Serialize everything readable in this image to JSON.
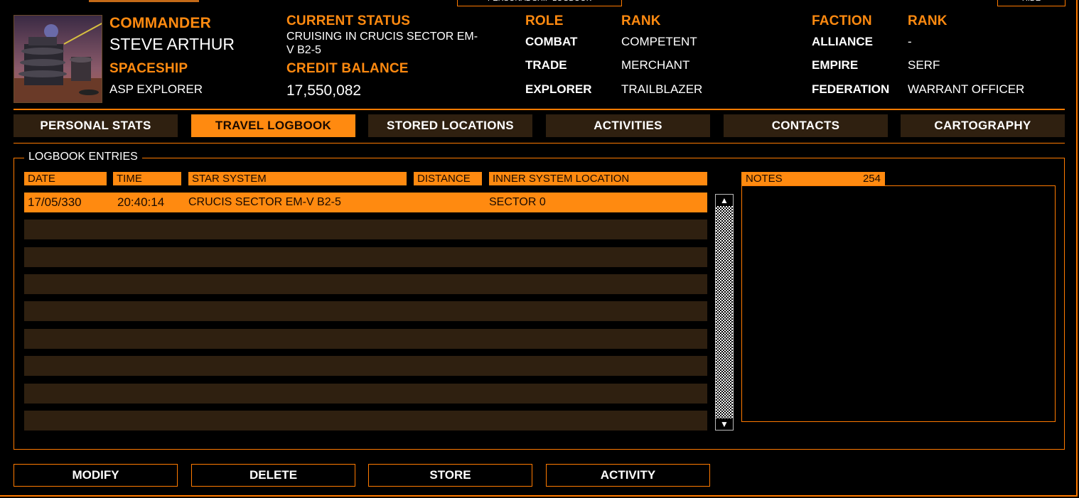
{
  "window": {
    "title": "PERSONAL SHIP LOGBOOK",
    "hide_label": "HIDE"
  },
  "header": {
    "commander_label": "COMMANDER",
    "commander_name": "STEVE ARTHUR",
    "spaceship_label": "SPACESHIP",
    "spaceship": "ASP EXPLORER",
    "status_label": "CURRENT STATUS",
    "status_line1": "CRUISING IN CRUCIS SECTOR EM-",
    "status_line2": "V B2-5",
    "credit_label": "CREDIT BALANCE",
    "credit": "17,550,082",
    "role_header": "ROLE",
    "role_rank_header": "RANK",
    "roles": [
      {
        "role": "COMBAT",
        "rank": "COMPETENT"
      },
      {
        "role": "TRADE",
        "rank": "MERCHANT"
      },
      {
        "role": "EXPLORER",
        "rank": "TRAILBLAZER"
      }
    ],
    "faction_header": "FACTION",
    "faction_rank_header": "RANK",
    "factions": [
      {
        "faction": "ALLIANCE",
        "rank": "-"
      },
      {
        "faction": "EMPIRE",
        "rank": "SERF"
      },
      {
        "faction": "FEDERATION",
        "rank": "WARRANT OFFICER"
      }
    ]
  },
  "tabs": [
    {
      "label": "PERSONAL STATS",
      "active": false
    },
    {
      "label": "TRAVEL LOGBOOK",
      "active": true
    },
    {
      "label": "STORED LOCATIONS",
      "active": false
    },
    {
      "label": "ACTIVITIES",
      "active": false
    },
    {
      "label": "CONTACTS",
      "active": false
    },
    {
      "label": "CARTOGRAPHY",
      "active": false
    }
  ],
  "logbook": {
    "title": "LOGBOOK ENTRIES",
    "columns": [
      "DATE",
      "TIME",
      "STAR SYSTEM",
      "DISTANCE",
      "INNER SYSTEM LOCATION"
    ],
    "entries": [
      {
        "date": "17/05/330",
        "time": "20:40:14",
        "system": "CRUCIS SECTOR EM-V B2-5",
        "distance": "",
        "location": "SECTOR 0"
      }
    ]
  },
  "notes": {
    "label": "NOTES",
    "count": "254"
  },
  "buttons": {
    "modify": "MODIFY",
    "delete": "DELETE",
    "store": "STORE",
    "activity": "ACTIVITY"
  },
  "colors": {
    "accent": "#ff8a10",
    "panel": "#2f2010",
    "background": "#000000"
  }
}
